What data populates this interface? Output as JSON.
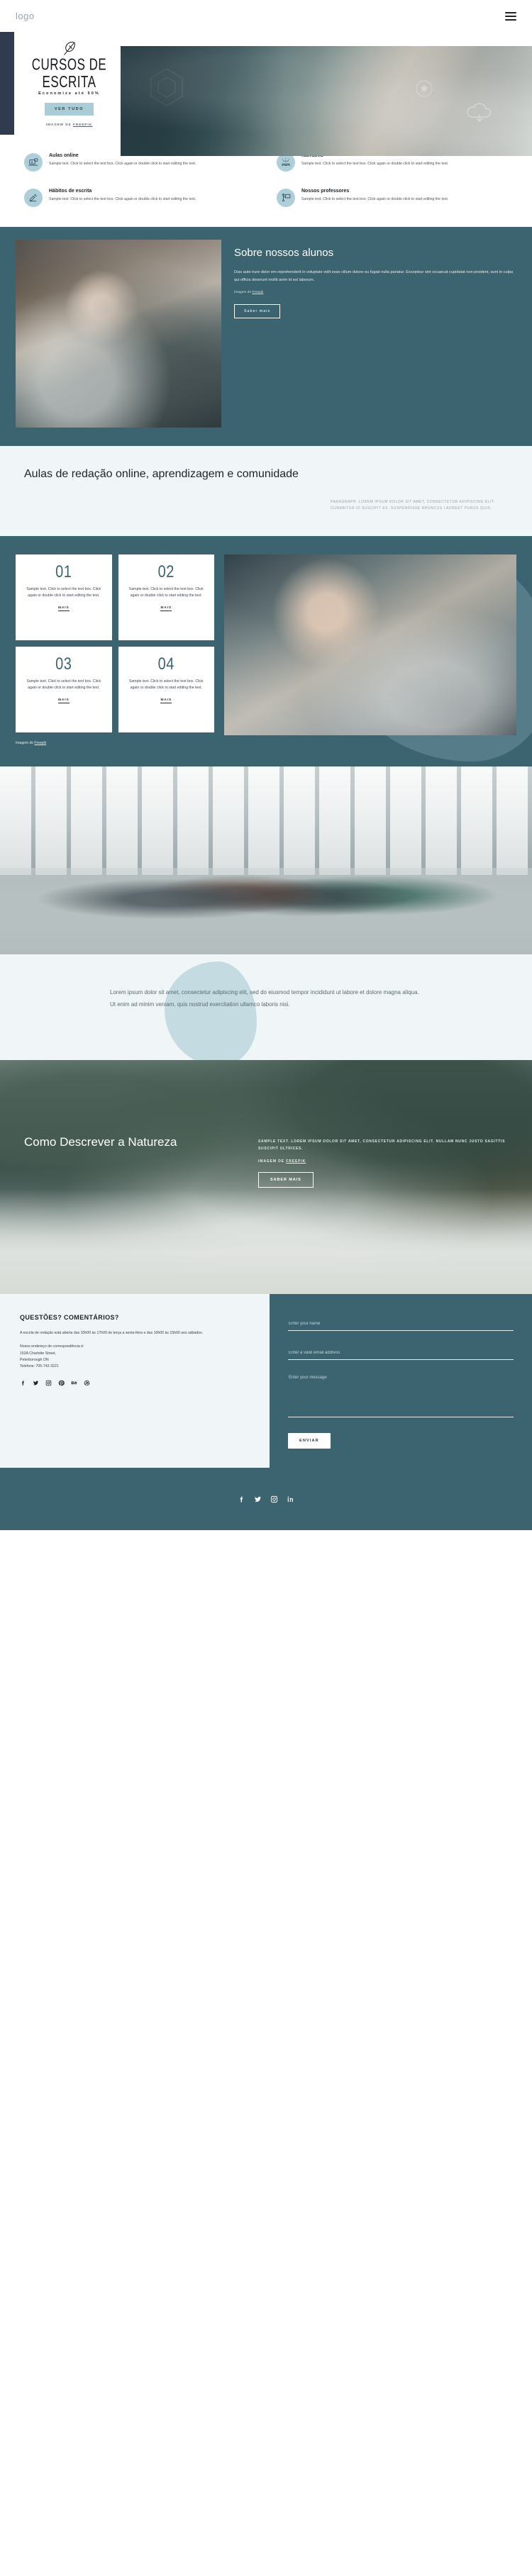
{
  "header": {
    "logo": "logo",
    "menu_icon": "hamburger-menu-icon"
  },
  "hero": {
    "feather_icon": "feather-icon",
    "title_line1": "CURSOS DE",
    "title_line2": "ESCRITA",
    "subtitle": "Economize até 50%",
    "cta": "VER TUDO",
    "credit_prefix": "IMAGEM DE ",
    "credit_link": "FREEPIK"
  },
  "features": [
    {
      "icon": "laptop-icon",
      "title": "Aulas online",
      "text": "Sample text. Click to select the text box. Click again or double click to start editing the text."
    },
    {
      "icon": "open-book-sparkle-icon",
      "title": "Narrativa",
      "text": "Sample text. Click to select the text box. Click again or double click to start editing the text."
    },
    {
      "icon": "writing-hand-icon",
      "title": "Hábitos de escrita",
      "text": "Sample text. Click to select the text box. Click again or double click to start editing the text."
    },
    {
      "icon": "teacher-board-icon",
      "title": "Nossos professores",
      "text": "Sample text. Click to select the text box. Click again or double click to start editing the text."
    }
  ],
  "about": {
    "heading": "Sobre nossos alunos",
    "paragraph": "Duis aute irure dolor em reprehenderit in voluptate velit esse cillum dolore eu fugiat nulla pariatur. Excepteur sint occaecat cupidatat non proident, sunt in culpa qui officia deserunt mollit anim id est laborum.",
    "credit_prefix": "Imagem de ",
    "credit_link": "Freepik",
    "cta": "Saber mais"
  },
  "band": {
    "heading": "Aulas de redação online, aprendizagem e comunidade",
    "paragraph": "PARAGRAPH. LOREM IPSUM DOLOR SIT AMET, CONSECTETUR ADIPISCING ELIT. CURABITUR ID SUSCIPIT EX. SUSPENDISSE RHONCUS LAOREET PURUS QUIS."
  },
  "numbers": {
    "cards": [
      {
        "number": "01",
        "text": "Sample text. Click to select the text box. Click again or double click to start editing the text.",
        "more": "MAIS"
      },
      {
        "number": "02",
        "text": "Sample text. Click to select the text box. Click again or double click to start editing the text.",
        "more": "MAIS"
      },
      {
        "number": "03",
        "text": "Sample text. Click to select the text box. Click again or double click to start editing the text.",
        "more": "MAIS"
      },
      {
        "number": "04",
        "text": "Sample text. Click to select the text box. Click again or double click to start editing the text.",
        "more": "MAIS"
      }
    ],
    "credit_prefix": "Imagem de ",
    "credit_link": "Freepik"
  },
  "lorem": {
    "paragraph": "Lorem ipsum dolor sit amet, consectetur adipiscing elit, sed do eiusmod tempor incididunt ut labore et dolore magna aliqua. Ut enim ad minim veniam, quis nostrud exercitation ullamco laboris nisi."
  },
  "nature": {
    "heading": "Como Descrever a Natureza",
    "paragraph": "SAMPLE TEXT. LOREM IPSUM DOLOR SIT AMET, CONSECTETUR ADIPISCING ELIT. NULLAM NUNC JUSTO SAGITTIS SUSCIPIT ULTRICES.",
    "credit_prefix": "IMAGEM DE ",
    "credit_link": "FREEPIK",
    "cta": "SABER MAIS"
  },
  "contact": {
    "heading": "QUESTÕES? COMENTÁRIOS?",
    "hours": "A escola de redação está aberta das 10h00 às 17h00 de terça a sexta-feira e das 10h00 às 15h00 aos sábados.",
    "address_label": "Nosso endereço de correspondência é:",
    "address_line1": "152A Charlotte Street,",
    "address_line2": "Peterborough ON",
    "phone": "Telefone: 705-742-3221",
    "socials": [
      "facebook-icon",
      "twitter-icon",
      "instagram-icon",
      "pinterest-icon",
      "behance-icon",
      "dribbble-icon"
    ],
    "form": {
      "name_placeholder": "Enter your name",
      "email_placeholder": "Enter a valid email address",
      "message_placeholder": "Enter your message",
      "submit": "ENVIAR"
    }
  },
  "footer": {
    "socials": [
      "facebook-icon",
      "twitter-icon",
      "instagram-icon",
      "linkedin-icon"
    ]
  },
  "colors": {
    "teal": "#3c6470",
    "navy": "#313b50",
    "light_blue": "#a9ccd7",
    "pale": "#f0f5f7"
  }
}
